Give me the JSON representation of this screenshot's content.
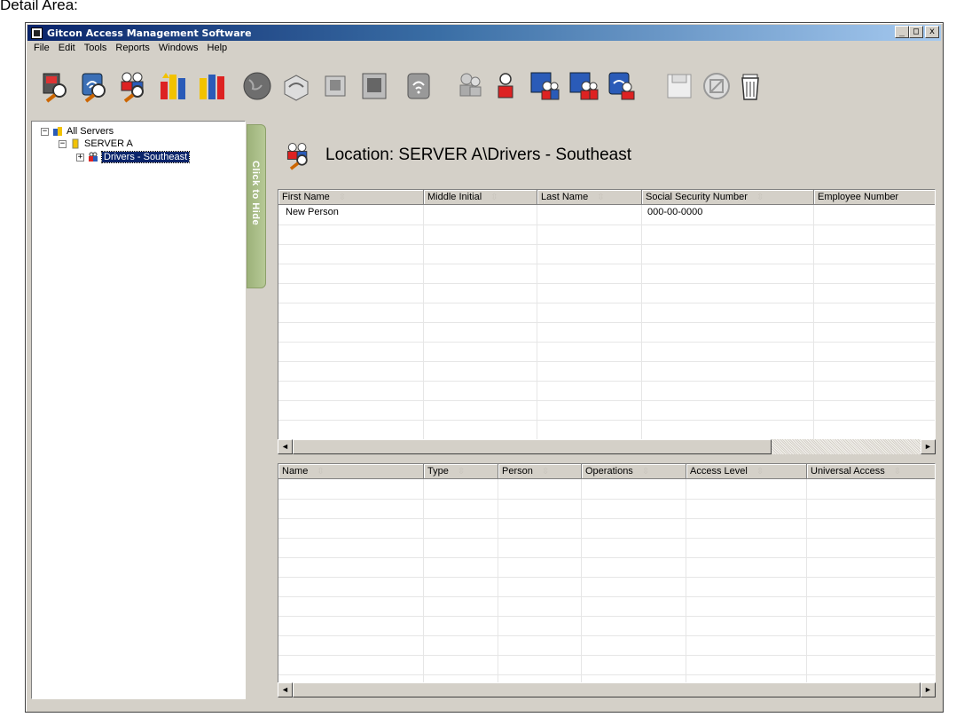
{
  "caption": "Detail Area:",
  "window": {
    "title": "Gitcon Access Management Software",
    "controls": [
      "_",
      "□",
      "x"
    ]
  },
  "menu": [
    "File",
    "Edit",
    "Tools",
    "Reports",
    "Windows",
    "Help"
  ],
  "toolbar": {
    "icons": [
      "server-search-icon",
      "wireless-search-icon",
      "people-search-icon",
      "report-icon",
      "report-red-icon",
      "globe-icon",
      "controller-icon",
      "reader-icon",
      "panel-icon",
      "wireless-reader-icon",
      "add-person-gray-icon",
      "person-red-icon",
      "group-access-icon",
      "group-access-red-icon",
      "group-wireless-icon",
      "save-icon",
      "cancel-icon",
      "delete-icon"
    ]
  },
  "tree": {
    "root": "All Servers",
    "server": "SERVER A",
    "location": "Drivers - Southeast"
  },
  "hide_tab": "Click to Hide",
  "location_label": "Location: SERVER A\\Drivers - Southeast",
  "people_grid": {
    "columns": [
      "First Name",
      "Middle Initial",
      "Last Name",
      "Social Security Number",
      "Employee Number"
    ],
    "rows": [
      [
        "New Person",
        "",
        "",
        "000-00-0000",
        ""
      ]
    ]
  },
  "access_grid": {
    "columns": [
      "Name",
      "Type",
      "Person",
      "Operations",
      "Access Level",
      "Universal Access"
    ],
    "rows": []
  },
  "sort_glyph": "⇳"
}
